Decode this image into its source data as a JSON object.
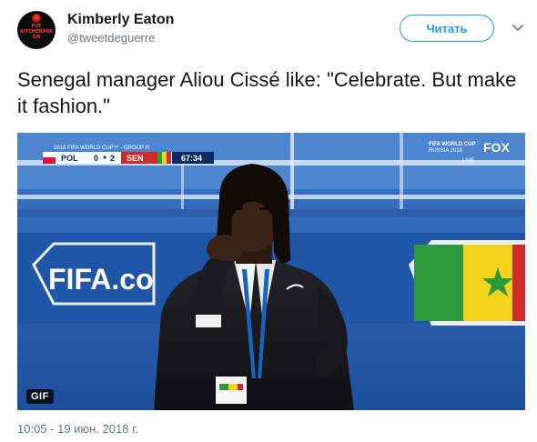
{
  "author": {
    "display_name": "Kimberly Eaton",
    "handle": "@tweetdeguerre",
    "avatar_text": [
      "PUT",
      "KITCHENAGE",
      "ON"
    ]
  },
  "follow_button": {
    "label": "Читать"
  },
  "tweet": {
    "text": "Senegal manager Aliou Cissé like: \"Celebrate. But make it fashion.\"",
    "timestamp": "10:05 - 19 июн. 2018 г."
  },
  "media": {
    "type": "GIF",
    "badge": "GIF",
    "scoreboard": {
      "competition": "2018 FIFA WORLD CUP™ - GROUP H",
      "team_home": "POL",
      "score_home": "0",
      "score_away": "2",
      "team_away": "SEN",
      "clock": "67:34"
    },
    "broadcast": {
      "event": "FIFA WORLD CUP",
      "event_sub": "RUSSIA 2018",
      "network": "FOX",
      "live": "LIVE"
    },
    "billboard_text": "FIFA.co"
  },
  "colors": {
    "accent": "#1da1f2",
    "secondary_text": "#657786",
    "primary_text": "#14171a"
  }
}
